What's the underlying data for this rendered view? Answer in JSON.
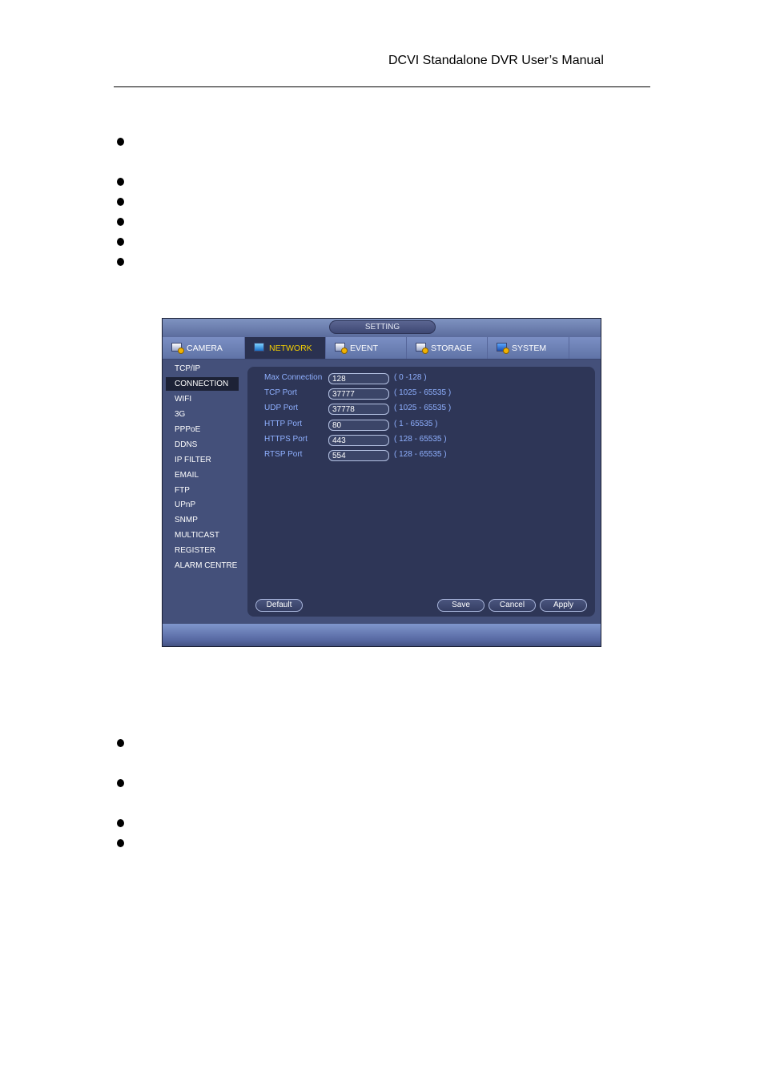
{
  "document": {
    "header_title": "DCVI Standalone DVR User’s Manual",
    "bullets_top_count": 6,
    "bullets_bottom_count": 4
  },
  "dvr": {
    "title": "SETTING",
    "tabs": [
      {
        "label": "CAMERA",
        "icon": "camera-gear-icon",
        "active": false
      },
      {
        "label": "NETWORK",
        "icon": "network-icon",
        "active": true
      },
      {
        "label": "EVENT",
        "icon": "event-gear-icon",
        "active": false
      },
      {
        "label": "STORAGE",
        "icon": "storage-gear-icon",
        "active": false
      },
      {
        "label": "SYSTEM",
        "icon": "system-gear-icon",
        "active": false
      }
    ],
    "sidebar": [
      {
        "label": "TCP/IP",
        "active": false
      },
      {
        "label": "CONNECTION",
        "active": true
      },
      {
        "label": "WIFI",
        "active": false
      },
      {
        "label": "3G",
        "active": false
      },
      {
        "label": "PPPoE",
        "active": false
      },
      {
        "label": "DDNS",
        "active": false
      },
      {
        "label": "IP FILTER",
        "active": false
      },
      {
        "label": "EMAIL",
        "active": false
      },
      {
        "label": "FTP",
        "active": false
      },
      {
        "label": "UPnP",
        "active": false
      },
      {
        "label": "SNMP",
        "active": false
      },
      {
        "label": "MULTICAST",
        "active": false
      },
      {
        "label": "REGISTER",
        "active": false
      },
      {
        "label": "ALARM CENTRE",
        "active": false
      }
    ],
    "fields": [
      {
        "label": "Max Connection",
        "value": "128",
        "range": "( 0 -128 )"
      },
      {
        "label": "TCP Port",
        "value": "37777",
        "range": "( 1025 - 65535 )"
      },
      {
        "label": "UDP Port",
        "value": "37778",
        "range": "( 1025 - 65535 )"
      },
      {
        "label": "HTTP Port",
        "value": "80",
        "range": "( 1 - 65535 )"
      },
      {
        "label": "HTTPS Port",
        "value": "443",
        "range": "( 128 - 65535 )"
      },
      {
        "label": "RTSP Port",
        "value": "554",
        "range": "( 128 - 65535 )"
      }
    ],
    "buttons": {
      "default": "Default",
      "save": "Save",
      "cancel": "Cancel",
      "apply": "Apply"
    },
    "colors": {
      "active_tab_text": "#f5d000",
      "field_label": "#8fb0ff",
      "panel_bg": "#2e3657",
      "sidebar_bg": "#44507a"
    }
  }
}
